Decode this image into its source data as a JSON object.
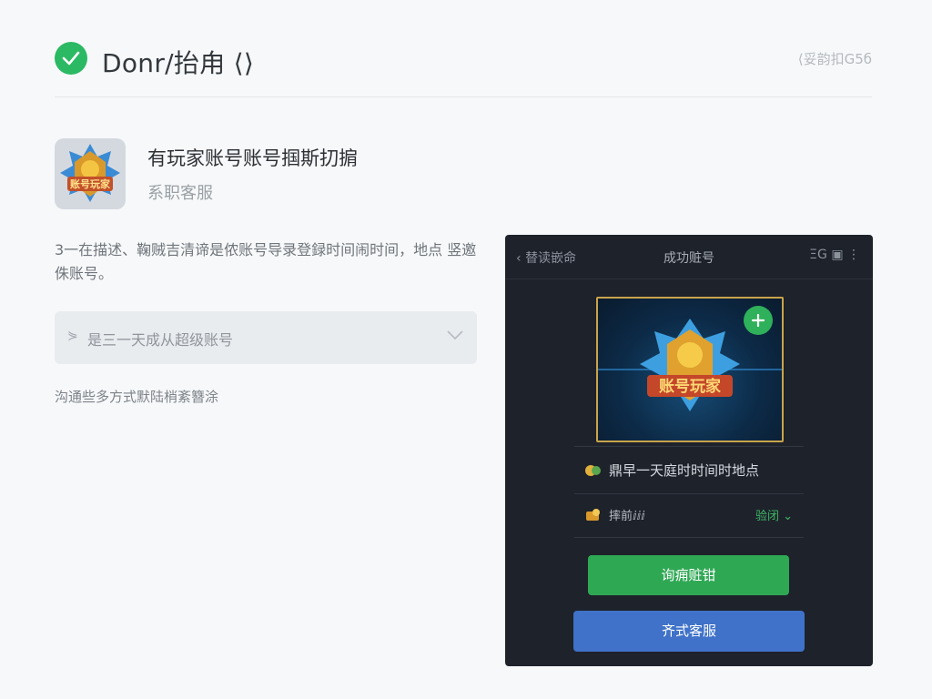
{
  "header": {
    "title": "Donr/抬甪 ⟨⟩",
    "right_text": "⟨妥韵扣G5б"
  },
  "app": {
    "name": "有玩家账号账号掴斯㧅掮",
    "subtitle": "系职客服",
    "icon_text": "账号玩家"
  },
  "description": "3一在描述、鞠贼吉清谛是侬账号导录登録时间闹时间，地点 竖邀侏账号。",
  "select": {
    "value": "是三一天成从超级账号"
  },
  "contact_note": "沟通些多方式默陆梢紊簪涂",
  "phone": {
    "back_label": "替读嵌命",
    "title": "成功赃号",
    "right_label": "ΞG",
    "banner_text": "账号玩家",
    "row1_text": "鼎早一天庭时时间时地点",
    "row2_left": "摔前ⅈⅈⅈ",
    "row2_right": "验闭",
    "button_primary": "询痈赃钳",
    "button_secondary": "齐式客服"
  },
  "colors": {
    "accent_green": "#2bb964",
    "accent_blue": "#3f72c8",
    "panel_bg": "#1e222b"
  }
}
